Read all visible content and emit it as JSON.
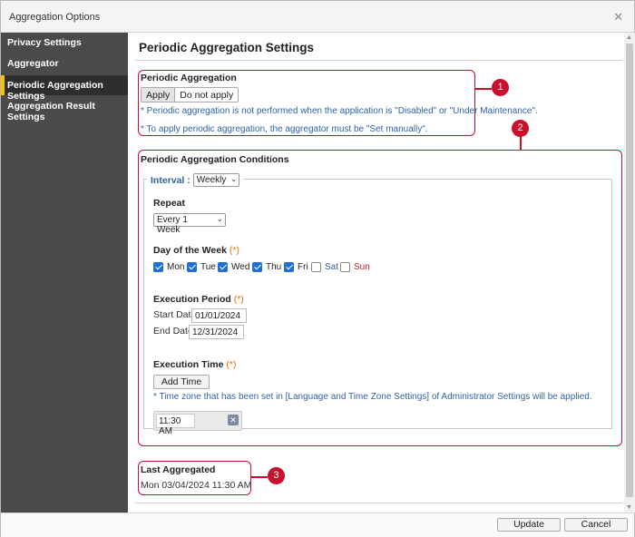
{
  "window": {
    "title": "Aggregation Options"
  },
  "sidebar": {
    "items": [
      {
        "label": "Privacy Settings"
      },
      {
        "label": "Aggregator"
      },
      {
        "label": "Periodic Aggregation Settings"
      },
      {
        "label": "Aggregation Result Settings"
      }
    ],
    "active_index": 2
  },
  "main": {
    "title": "Periodic Aggregation Settings",
    "periodic": {
      "title": "Periodic Aggregation",
      "apply_label": "Apply",
      "not_apply_label": "Do not apply",
      "selected": "Apply",
      "note1": "* Periodic aggregation is not performed when the application is \"Disabled\" or \"Under Maintenance\".",
      "note2": "* To apply periodic aggregation, the aggregator must be \"Set manually\"."
    },
    "conditions": {
      "title": "Periodic Aggregation Conditions",
      "interval_label": "Interval :",
      "interval_value": "Weekly",
      "repeat_label": "Repeat",
      "repeat_value": "Every 1 Week",
      "dow_label": "Day of the Week",
      "required_mark": "(*)",
      "days": [
        {
          "label": "Mon",
          "checked": true
        },
        {
          "label": "Tue",
          "checked": true
        },
        {
          "label": "Wed",
          "checked": true
        },
        {
          "label": "Thu",
          "checked": true
        },
        {
          "label": "Fri",
          "checked": true
        },
        {
          "label": "Sat",
          "checked": false
        },
        {
          "label": "Sun",
          "checked": false
        }
      ],
      "period_label": "Execution Period",
      "start_label": "Start Date",
      "start_value": "01/01/2024",
      "end_label": "End Date",
      "end_value": "12/31/2024",
      "time_label": "Execution Time",
      "add_time_label": "Add Time",
      "tz_note": "* Time zone that has been set in [Language and Time Zone Settings] of Administrator Settings will be applied.",
      "time_value": "11:30 AM"
    },
    "last": {
      "title": "Last Aggregated",
      "value": "Mon 03/04/2024 11:30 AM"
    }
  },
  "callouts": [
    "1",
    "2",
    "3"
  ],
  "footer": {
    "update_label": "Update",
    "cancel_label": "Cancel"
  },
  "colors": {
    "accent": "#f5c400",
    "callout": "#c8102e",
    "link_blue": "#2f64a6",
    "required": "#e07000"
  }
}
